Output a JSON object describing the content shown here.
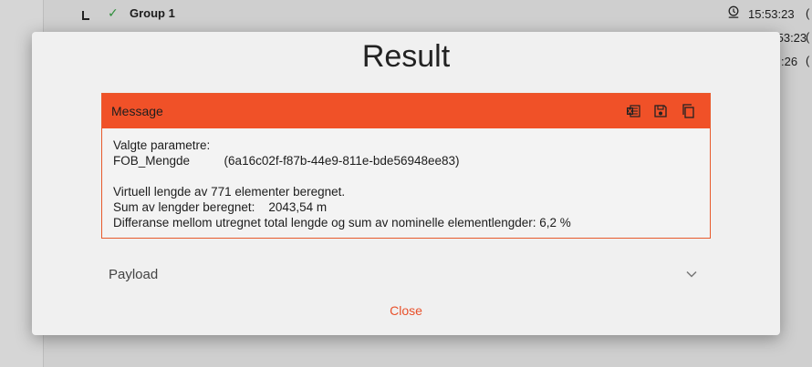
{
  "background": {
    "row_group_label": "Group 1",
    "times": [
      "15:53:23",
      "15:53:23",
      "15:53:26"
    ],
    "time_snippets": [
      "15:53:23",
      ":53:23",
      ":26"
    ]
  },
  "dialog": {
    "title": "Result",
    "message": {
      "header_label": "Message",
      "icons": [
        "export-excel-icon",
        "save-icon",
        "copy-icon"
      ],
      "lines": [
        "Valgte parametre:",
        "FOB_Mengde          (6a16c02f-f87b-44e9-811e-bde56948ee83)",
        "",
        "Virtuell lengde av 771 elementer beregnet.",
        "Sum av lengder beregnet:    2043,54 m",
        "Differanse mellom utregnet total lengde og sum av nominelle elementlengder: 6,2 %"
      ]
    },
    "payload_label": "Payload",
    "close_label": "Close"
  },
  "colors": {
    "accent": "#f05128",
    "close_text": "#e8502a"
  }
}
